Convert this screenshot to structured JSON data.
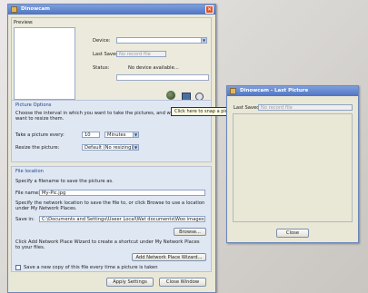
{
  "main_window": {
    "title": "Dinowcam",
    "preview_label": "Preview:",
    "device_label": "Device:",
    "last_saved_label": "Last Saved:",
    "last_saved_value": "No record file",
    "status_label": "Status:",
    "status_value": "No device available...",
    "tooltip": "Click here to snap a picture now",
    "picture_options": {
      "heading": "Picture Options",
      "description": "Choose the interval in which you want to take the pictures, and whether you want to resize them.",
      "interval_label": "Take a picture every:",
      "interval_value": "10",
      "interval_unit": "Minutes",
      "resize_label": "Resize the picture:",
      "resize_value": "Default (No resizing)"
    },
    "file_location": {
      "heading": "File location",
      "filename_description": "Specify a filename to save the picture as.",
      "filename_label": "File name:",
      "filename_value": "My-Pic.jpg",
      "network_description": "Specify the network location to save the file to, or click Browse to use a location under My Network Places.",
      "save_in_label": "Save in:",
      "save_in_value": "C:\\Documents and Settings\\Useer Local\\Wat documents\\Woo images",
      "browse_button": "Browse...",
      "wizard_description": "Click Add Network Place Wizard to create a shortcut under My Network Places to your files.",
      "wizard_button": "Add Network Place Wizard...",
      "checkbox_label": "Save a new copy of this file every time a picture is taken"
    },
    "apply_button": "Apply Settings",
    "close_button": "Close Window"
  },
  "last_picture_window": {
    "title": "Dinowcam - Last Picture",
    "last_saved_label": "Last Saved:",
    "last_saved_value": "No record file",
    "close_button": "Close"
  },
  "colors": {
    "titlebar": "#4f74c4",
    "window_bg": "#e9e7d6",
    "close": "#d9552c"
  }
}
